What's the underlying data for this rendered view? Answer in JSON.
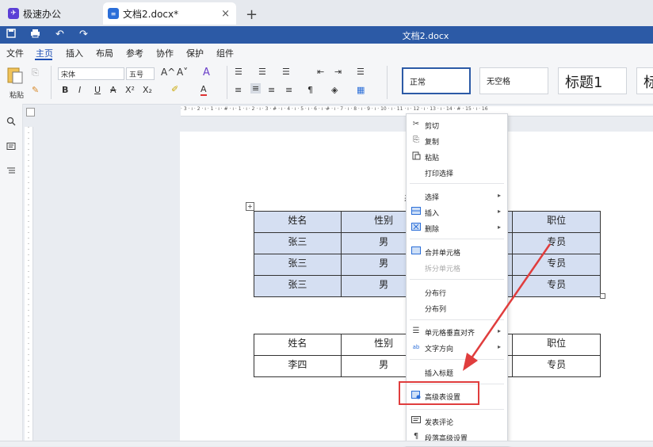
{
  "tabs": [
    {
      "label": "极速办公",
      "icon": "app-logo"
    },
    {
      "label": "文档2.docx*",
      "icon": "doc-logo",
      "close": "×"
    }
  ],
  "new_tab": "+",
  "window_title": "文档2.docx",
  "menu": [
    "文件",
    "主页",
    "插入",
    "布局",
    "参考",
    "协作",
    "保护",
    "组件"
  ],
  "ribbon": {
    "paste_label": "粘贴",
    "font_name": "宋体",
    "font_size": "五号",
    "bold": "B",
    "italic": "I",
    "underline": "U",
    "strike": "A",
    "superscript": "X²",
    "subscript": "X₂",
    "grow_font": "A^",
    "shrink_font": "A˅",
    "clear_format": "A",
    "styles": [
      "正常",
      "无空格",
      "标题1",
      "标"
    ]
  },
  "ruler_marks": "· 3 · ı · 2 · ı · 1 · ı ·  # · ı · 1 · ı · 2 · ı · 3 · # · ı · 4 · ı · 5 · ı · 6 · ı ·# · ı · 7 · ı · 8 · ı · 9 · ı · 10 · ı · 11 · ı · 12 · ı · 13 · ı · 14 · # · 15 · ı · 16",
  "caption_fragment": "表",
  "table1": {
    "header": [
      "姓名",
      "性别",
      "",
      "职位"
    ],
    "rows": [
      [
        "张三",
        "男",
        "",
        "专员"
      ],
      [
        "张三",
        "男",
        "",
        "专员"
      ],
      [
        "张三",
        "男",
        "",
        "专员"
      ]
    ]
  },
  "table2": {
    "header": [
      "姓名",
      "性别",
      "",
      "职位"
    ],
    "rows": [
      [
        "李四",
        "男",
        "",
        "专员"
      ]
    ]
  },
  "context_menu": [
    {
      "label": "剪切",
      "icon": "scissors-icon",
      "glyph": "✂",
      "disabled": false,
      "arrow": false
    },
    {
      "label": "复制",
      "icon": "copy-icon",
      "glyph": "⎘",
      "disabled": false,
      "arrow": false
    },
    {
      "label": "粘贴",
      "icon": "paste-icon",
      "glyph": "📋",
      "disabled": false,
      "arrow": false
    },
    {
      "label": "打印选择",
      "icon": "",
      "glyph": "",
      "disabled": false,
      "arrow": false
    },
    {
      "label": "选择",
      "icon": "",
      "glyph": "",
      "disabled": false,
      "arrow": true
    },
    {
      "label": "插入",
      "icon": "insert-row-icon",
      "glyph": "⊞",
      "disabled": false,
      "arrow": true
    },
    {
      "label": "删除",
      "icon": "delete-row-icon",
      "glyph": "⊠",
      "disabled": false,
      "arrow": true
    },
    {
      "label": "合并单元格",
      "icon": "merge-cells-icon",
      "glyph": "▦",
      "disabled": false,
      "arrow": false
    },
    {
      "label": "拆分单元格",
      "icon": "",
      "glyph": "",
      "disabled": true,
      "arrow": false
    },
    {
      "label": "分布行",
      "icon": "",
      "glyph": "",
      "disabled": false,
      "arrow": false
    },
    {
      "label": "分布列",
      "icon": "",
      "glyph": "",
      "disabled": false,
      "arrow": false
    },
    {
      "label": "单元格垂直对齐",
      "icon": "vertical-align-icon",
      "glyph": "☰",
      "disabled": false,
      "arrow": true
    },
    {
      "label": "文字方向",
      "icon": "text-direction-icon",
      "glyph": "ab",
      "disabled": false,
      "arrow": true
    },
    {
      "label": "插入标题",
      "icon": "",
      "glyph": "",
      "disabled": false,
      "arrow": false
    },
    {
      "label": "高级表设置",
      "icon": "table-settings-icon",
      "glyph": "▤",
      "disabled": false,
      "arrow": false
    },
    {
      "label": "发表评论",
      "icon": "comment-icon",
      "glyph": "▭",
      "disabled": false,
      "arrow": false
    },
    {
      "label": "段落高级设置",
      "icon": "paragraph-icon",
      "glyph": "¶",
      "disabled": false,
      "arrow": false
    }
  ],
  "colors": {
    "accent": "#2c5aa6",
    "highlight": "#e03d3d",
    "table_selection": "#d5dff2"
  }
}
